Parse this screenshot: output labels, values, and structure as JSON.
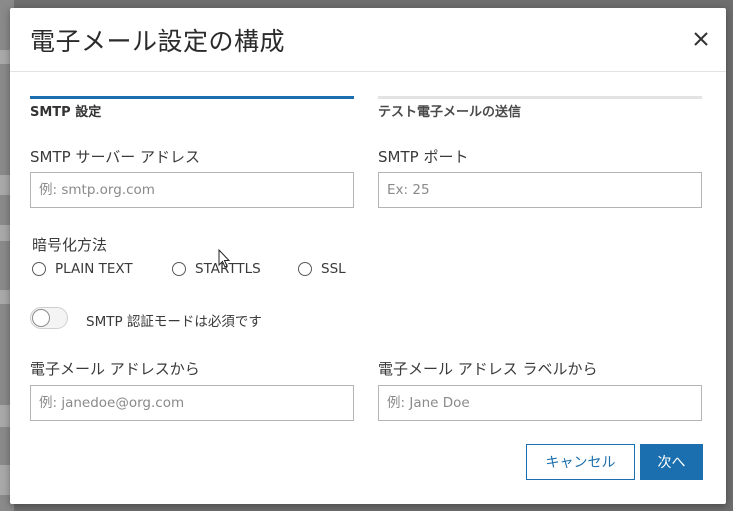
{
  "dialog": {
    "title": "電子メール設定の構成",
    "close_icon": "close-icon"
  },
  "tabs": [
    {
      "label": "SMTP 設定",
      "active": true
    },
    {
      "label": "テスト電子メールの送信",
      "active": false
    }
  ],
  "smtp_server": {
    "label": "SMTP サーバー アドレス",
    "placeholder": "例: smtp.org.com",
    "value": ""
  },
  "smtp_port": {
    "label": "SMTP ポート",
    "placeholder": "Ex: 25",
    "value": ""
  },
  "encryption": {
    "label": "暗号化方法",
    "options": [
      "PLAIN TEXT",
      "STARTTLS",
      "SSL"
    ],
    "selected": null
  },
  "auth_toggle": {
    "label": "SMTP 認証モードは必須です",
    "on": false
  },
  "from_address": {
    "label": "電子メール アドレスから",
    "placeholder": "例: janedoe@org.com",
    "value": ""
  },
  "from_label": {
    "label": "電子メール アドレス ラベルから",
    "placeholder": "例: Jane Doe",
    "value": ""
  },
  "buttons": {
    "cancel": "キャンセル",
    "next": "次へ"
  },
  "colors": {
    "accent": "#1b6fae",
    "overlay": "#6e6e6e"
  }
}
